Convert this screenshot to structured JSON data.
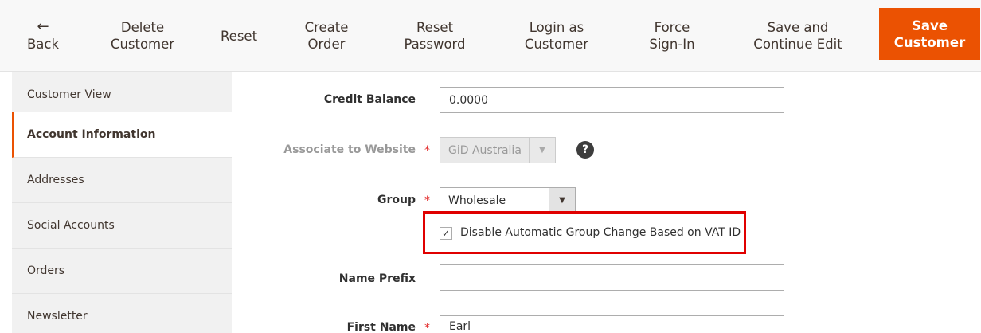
{
  "toolbar": {
    "back_icon": "←",
    "back_label": "Back",
    "delete_line1": "Delete",
    "delete_line2": "Customer",
    "reset_label": "Reset",
    "create_line1": "Create",
    "create_line2": "Order",
    "reset_pw_line1": "Reset",
    "reset_pw_line2": "Password",
    "login_line1": "Login as",
    "login_line2": "Customer",
    "force_line1": "Force",
    "force_line2": "Sign-In",
    "save_continue_line1": "Save and",
    "save_continue_line2": "Continue Edit",
    "save_line1": "Save",
    "save_line2": "Customer"
  },
  "sidebar": {
    "items": [
      {
        "label": "Customer View"
      },
      {
        "label": "Account Information"
      },
      {
        "label": "Addresses"
      },
      {
        "label": "Social Accounts"
      },
      {
        "label": "Orders"
      },
      {
        "label": "Newsletter"
      }
    ]
  },
  "form": {
    "credit_balance_label": "Credit Balance",
    "credit_balance_value": "0.0000",
    "website_label": "Associate to Website",
    "website_value": "GiD Australia",
    "required_mark": "*",
    "help_icon": "?",
    "group_label": "Group",
    "group_value": "Wholesale",
    "arrow_icon": "▼",
    "vat_checked": "✓",
    "vat_label": "Disable Automatic Group Change Based on VAT ID",
    "name_prefix_label": "Name Prefix",
    "name_prefix_value": "",
    "first_name_label": "First Name",
    "first_name_value": "Earl"
  },
  "colors": {
    "accent": "#eb5202",
    "highlight": "#e00000",
    "required": "#e22626"
  }
}
